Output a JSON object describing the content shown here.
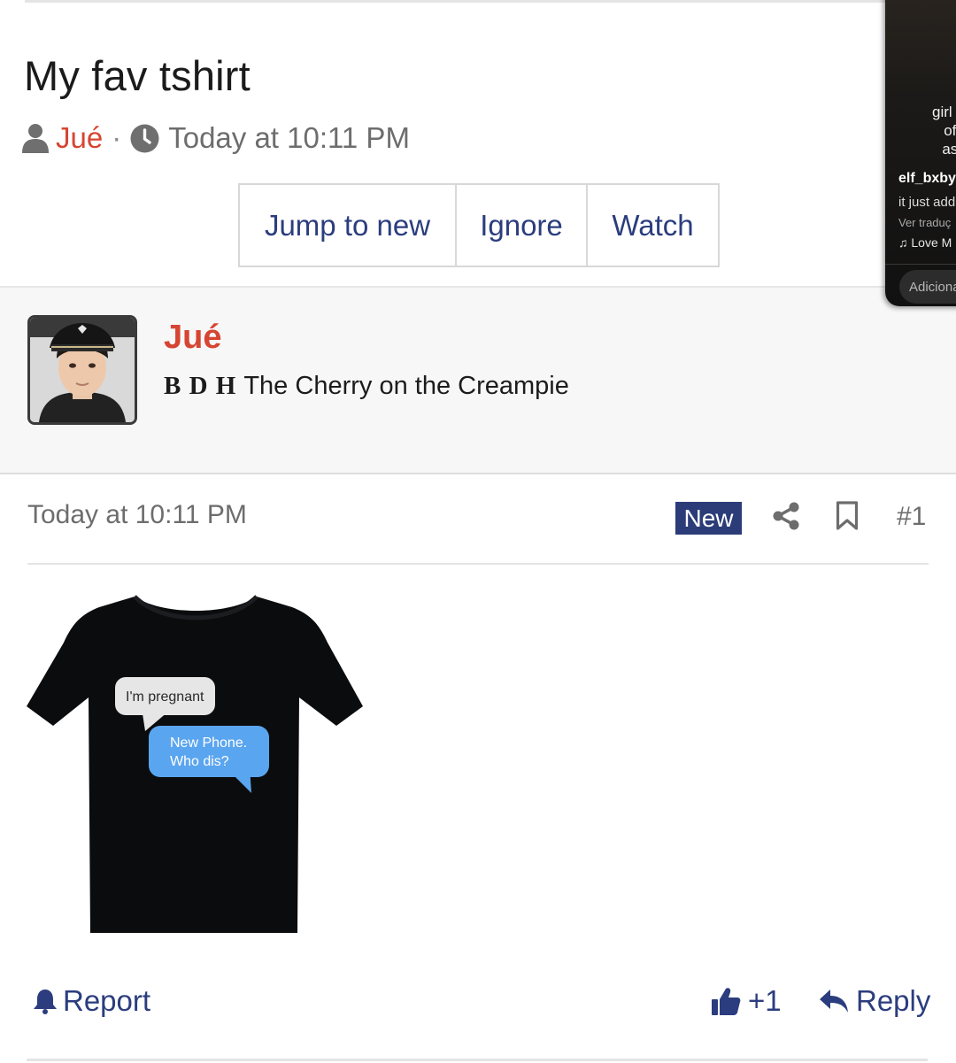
{
  "thread": {
    "title": "My fav tshirt",
    "author": "Jué",
    "separator": "·",
    "time": "Today at 10:11 PM",
    "buttons": {
      "jump": "Jump to new",
      "ignore": "Ignore",
      "watch": "Watch"
    }
  },
  "post": {
    "author": "Jué",
    "user_title_tags": "B D H",
    "user_title": "The Cherry on the Creampie",
    "date": "Today at 10:11 PM",
    "badge": "New",
    "number": "#1",
    "image": {
      "bubble_grey": "I'm pregnant",
      "bubble_blue_line1": "New Phone.",
      "bubble_blue_line2": "Who dis?"
    },
    "actions": {
      "report": "Report",
      "like": "+1",
      "reply": "Reply"
    }
  },
  "overlay": {
    "caption_line1": "girl ma",
    "caption_line2": "of be",
    "caption_line3": "askin",
    "username": "elf_bxby",
    "comment": "it just add",
    "translate": "Ver traduç",
    "music": "Love M",
    "input_placeholder": "Adiciona"
  },
  "colors": {
    "accent": "#2b3d7e",
    "author": "#d64532",
    "badge": "#2b3c78",
    "bubble_blue": "#5aa5ef"
  },
  "icons": [
    "user-icon",
    "clock-icon",
    "share-icon",
    "bookmark-icon",
    "bell-icon",
    "thumbs-up-icon",
    "reply-arrow-icon",
    "music-note-icon"
  ]
}
